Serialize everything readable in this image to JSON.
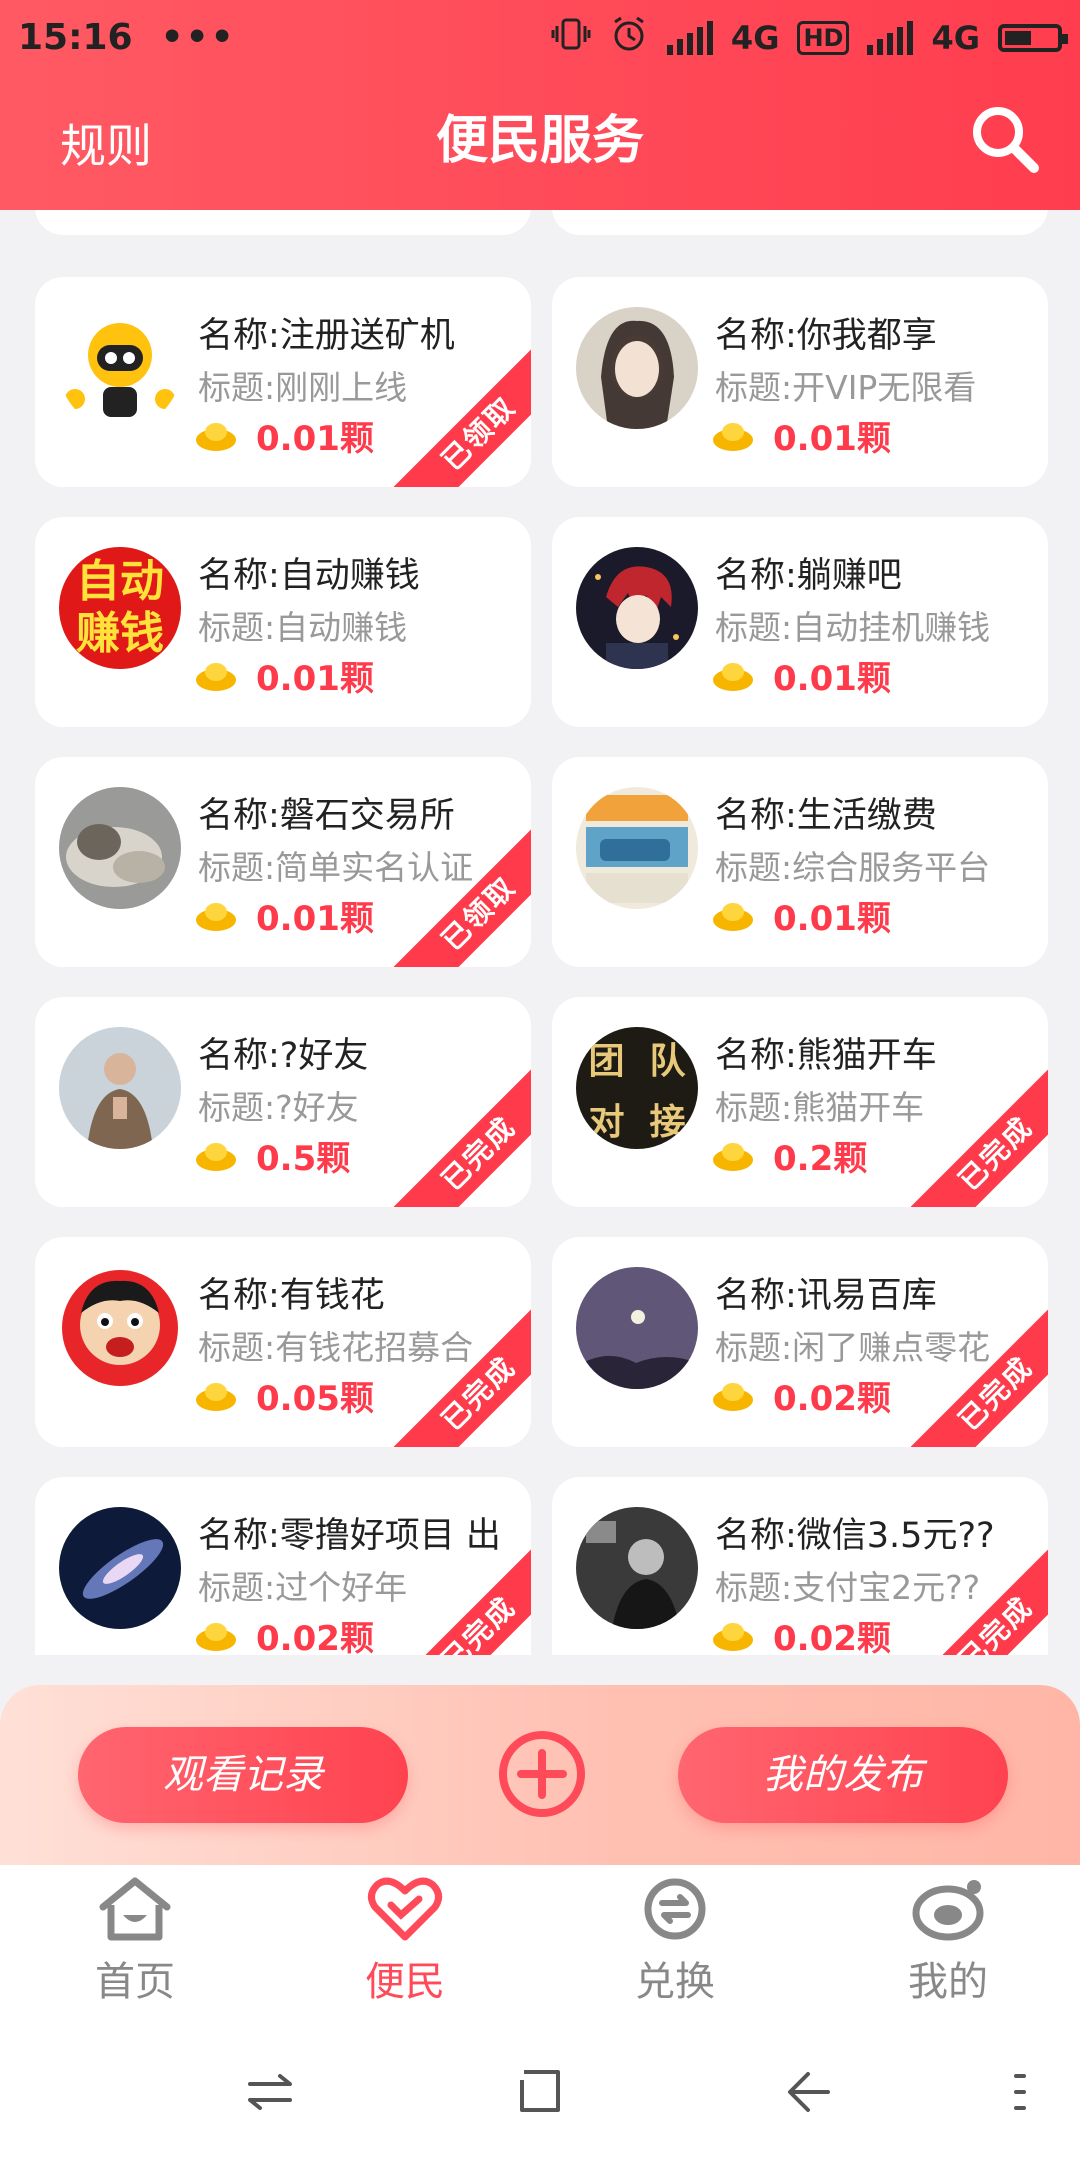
{
  "status": {
    "time": "15:16",
    "dots": "•••",
    "net1": "4G",
    "hd": "HD",
    "net2": "4G"
  },
  "header": {
    "rule": "规则",
    "title": "便民服务"
  },
  "cards": [
    {
      "name": "名称:注册送矿机",
      "subtitle": "标题:刚刚上线",
      "amount": "0.01颗",
      "status": "已领取"
    },
    {
      "name": "名称:你我都享",
      "subtitle": "标题:开VIP无限看",
      "amount": "0.01颗",
      "status": ""
    },
    {
      "name": "名称:自动赚钱",
      "subtitle": "标题:自动赚钱",
      "amount": "0.01颗",
      "status": ""
    },
    {
      "name": "名称:躺赚吧",
      "subtitle": "标题:自动挂机赚钱",
      "amount": "0.01颗",
      "status": ""
    },
    {
      "name": "名称:磐石交易所",
      "subtitle": "标题:简单实名认证",
      "amount": "0.01颗",
      "status": "已领取"
    },
    {
      "name": "名称:生活缴费",
      "subtitle": "标题:综合服务平台",
      "amount": "0.01颗",
      "status": ""
    },
    {
      "name": "名称:?好友",
      "subtitle": "标题:?好友",
      "amount": "0.5颗",
      "status": "已完成"
    },
    {
      "name": "名称:熊猫开车",
      "subtitle": "标题:熊猫开车",
      "amount": "0.2颗",
      "status": "已完成"
    },
    {
      "name": "名称:有钱花",
      "subtitle": "标题:有钱花招募合",
      "amount": "0.05颗",
      "status": "已完成"
    },
    {
      "name": "名称:讯易百库",
      "subtitle": "标题:闲了赚点零花",
      "amount": "0.02颗",
      "status": "已完成"
    },
    {
      "name": "名称:零撸好项目 出",
      "subtitle": "标题:过个好年",
      "amount": "0.02颗",
      "status": "已完成"
    },
    {
      "name": "名称:微信3.5元??",
      "subtitle": "标题:支付宝2元??",
      "amount": "0.02颗",
      "status": "已完成"
    }
  ],
  "avatar_text": {
    "card3_top": "自动",
    "card3_bottom": "赚钱",
    "card8": [
      "团",
      "队",
      "对",
      "接"
    ]
  },
  "actions": {
    "history": "观看记录",
    "publish": "我的发布"
  },
  "tabs": [
    {
      "label": "首页",
      "icon": "home-icon"
    },
    {
      "label": "便民",
      "icon": "heart-icon"
    },
    {
      "label": "兑换",
      "icon": "exchange-icon"
    },
    {
      "label": "我的",
      "icon": "profile-icon"
    }
  ],
  "colors": {
    "brand": "#ff3d4f",
    "accent_text": "#ff3b4b",
    "muted": "#999999",
    "active_tab": "#ff4a5a"
  }
}
